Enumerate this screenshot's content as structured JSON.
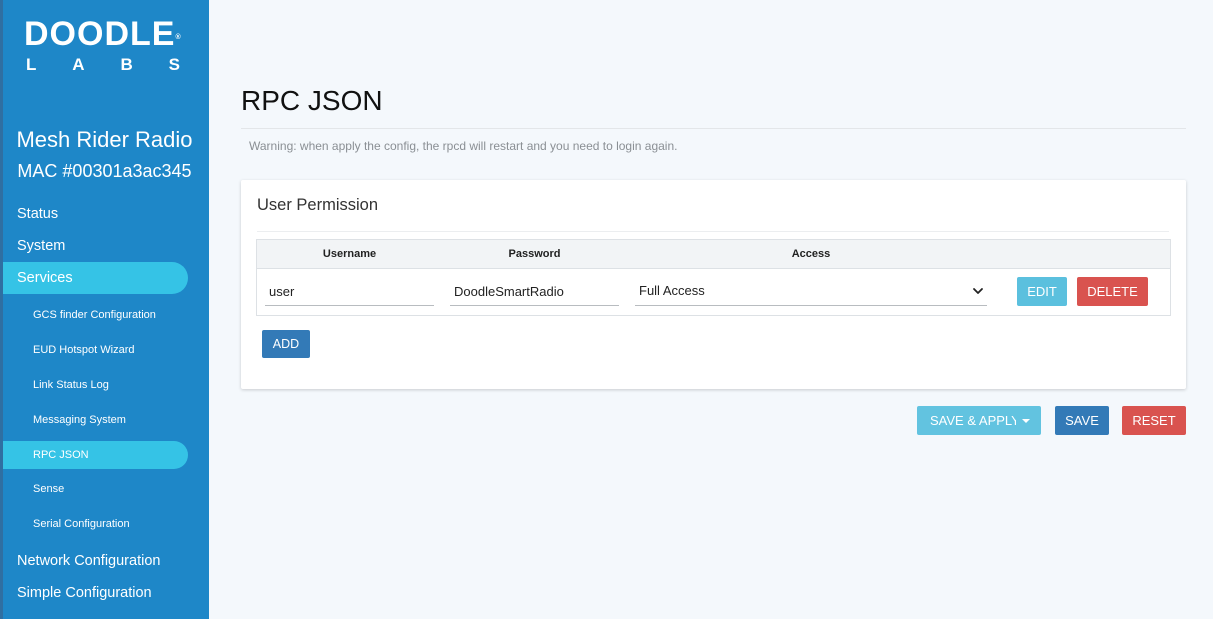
{
  "brand": {
    "logo_top": "DOODLE",
    "logo_reg": "®",
    "logo_bottom": [
      "L",
      "A",
      "B",
      "S"
    ],
    "device_name": "Mesh Rider Radio",
    "device_mac": "MAC #00301a3ac345"
  },
  "sidebar": {
    "items": [
      {
        "label": "Status"
      },
      {
        "label": "System"
      },
      {
        "label": "Services",
        "active": true
      },
      {
        "label": "Network Configuration"
      },
      {
        "label": "Simple Configuration"
      }
    ],
    "sub_items": [
      {
        "label": "GCS finder Configuration"
      },
      {
        "label": "EUD Hotspot Wizard"
      },
      {
        "label": "Link Status Log"
      },
      {
        "label": "Messaging System"
      },
      {
        "label": "RPC JSON",
        "active": true
      },
      {
        "label": "Sense"
      },
      {
        "label": "Serial Configuration"
      }
    ]
  },
  "page": {
    "title": "RPC JSON",
    "warning": "Warning: when apply the config, the rpcd will restart and you need to login again."
  },
  "panel": {
    "title": "User Permission",
    "columns": [
      "Username",
      "Password",
      "Access"
    ],
    "rows": [
      {
        "username": "user",
        "password": "DoodleSmartRadio",
        "access": "Full Access"
      }
    ],
    "edit_label": "EDIT",
    "delete_label": "DELETE",
    "add_label": "ADD"
  },
  "actions": {
    "save_apply_label": "SAVE & APPLY",
    "save_label": "SAVE",
    "reset_label": "RESET"
  },
  "colors": {
    "sidebar": "#1e87c8",
    "active": "#35c3e6",
    "info": "#5bc0de",
    "danger": "#d9534f",
    "primary": "#337ab7"
  }
}
